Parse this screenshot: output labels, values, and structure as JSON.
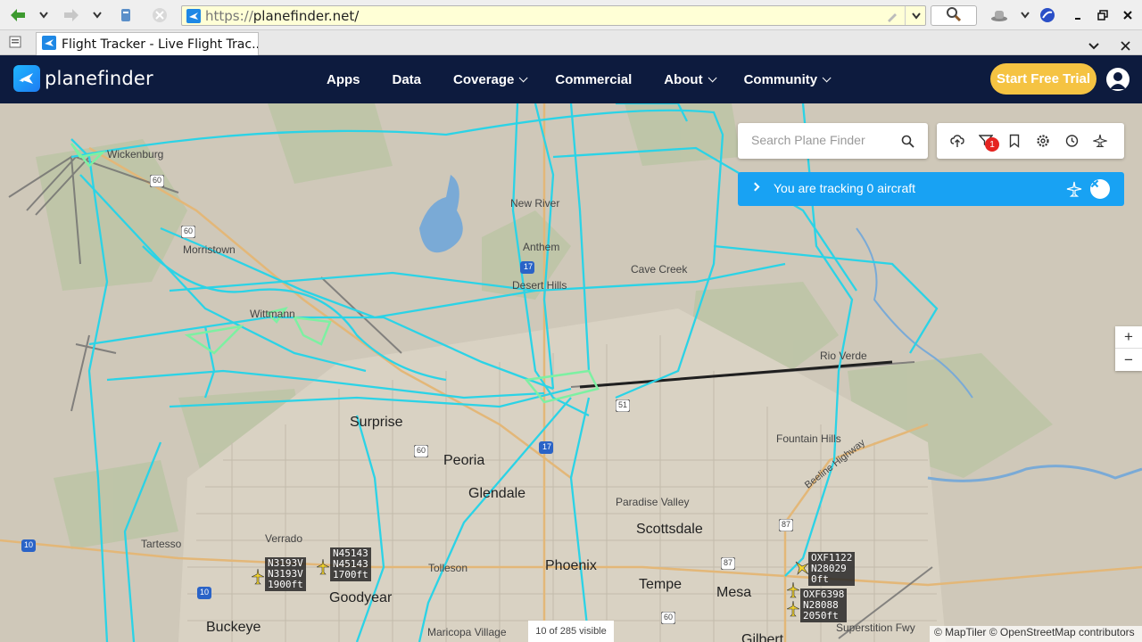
{
  "browser": {
    "url_protocol": "https://",
    "url_host": "planefinder.net/",
    "tab_title": "Flight Tracker - Live Flight Trac..."
  },
  "header": {
    "logo_text": "planefinder",
    "nav": [
      {
        "label": "Apps",
        "dropdown": false
      },
      {
        "label": "Data",
        "dropdown": false
      },
      {
        "label": "Coverage",
        "dropdown": true
      },
      {
        "label": "Commercial",
        "dropdown": false
      },
      {
        "label": "About",
        "dropdown": true
      },
      {
        "label": "Community",
        "dropdown": true
      }
    ],
    "trial_label": "Start Free Trial",
    "brand_color": "#0d1b3e",
    "trial_color": "#f5c342"
  },
  "search": {
    "placeholder": "Search Plane Finder"
  },
  "toolbar": {
    "filter_badge": "1"
  },
  "tracking": {
    "text": "You are tracking 0 aircraft",
    "color": "#18a2f3"
  },
  "zoom": {
    "in": "+",
    "out": "−"
  },
  "map": {
    "visible_count": "10 of 285 visible",
    "attribution": "© MapTiler © OpenStreetMap contributors",
    "places": [
      {
        "name": "Wickenburg",
        "size": "small"
      },
      {
        "name": "Morristown",
        "size": "small"
      },
      {
        "name": "New River",
        "size": "small"
      },
      {
        "name": "Anthem",
        "size": "small"
      },
      {
        "name": "Desert Hills",
        "size": "small"
      },
      {
        "name": "Cave Creek",
        "size": "small"
      },
      {
        "name": "Wittmann",
        "size": "small"
      },
      {
        "name": "Rio Verde",
        "size": "small"
      },
      {
        "name": "Surprise",
        "size": "big"
      },
      {
        "name": "Fountain Hills",
        "size": "small"
      },
      {
        "name": "Peoria",
        "size": "big"
      },
      {
        "name": "Glendale",
        "size": "big"
      },
      {
        "name": "Paradise Valley",
        "size": "small"
      },
      {
        "name": "Scottsdale",
        "size": "big"
      },
      {
        "name": "Tartesso",
        "size": "small"
      },
      {
        "name": "Verrado",
        "size": "small"
      },
      {
        "name": "Tolleson",
        "size": "small"
      },
      {
        "name": "Phoenix",
        "size": "big"
      },
      {
        "name": "Tempe",
        "size": "big"
      },
      {
        "name": "Mesa",
        "size": "big"
      },
      {
        "name": "Goodyear",
        "size": "big"
      },
      {
        "name": "Buckeye",
        "size": "big"
      },
      {
        "name": "Maricopa Village",
        "size": "small"
      },
      {
        "name": "Gilbert",
        "size": "big"
      },
      {
        "name": "Superstition Fwy",
        "size": "small"
      },
      {
        "name": "Beeline Highway",
        "size": "small"
      }
    ],
    "highways": [
      "60",
      "60",
      "17",
      "51",
      "60",
      "17",
      "10",
      "10",
      "87",
      "87",
      "60"
    ],
    "aircraft": [
      {
        "lines": [
          "N3193V",
          "N3193V",
          "1900ft"
        ]
      },
      {
        "lines": [
          "N45143",
          "N45143",
          "1700ft"
        ]
      },
      {
        "lines": [
          "OXF1122",
          "N28029",
          "0ft"
        ]
      },
      {
        "lines": [
          "OXF6398",
          "N28088",
          "2050ft"
        ]
      }
    ]
  }
}
